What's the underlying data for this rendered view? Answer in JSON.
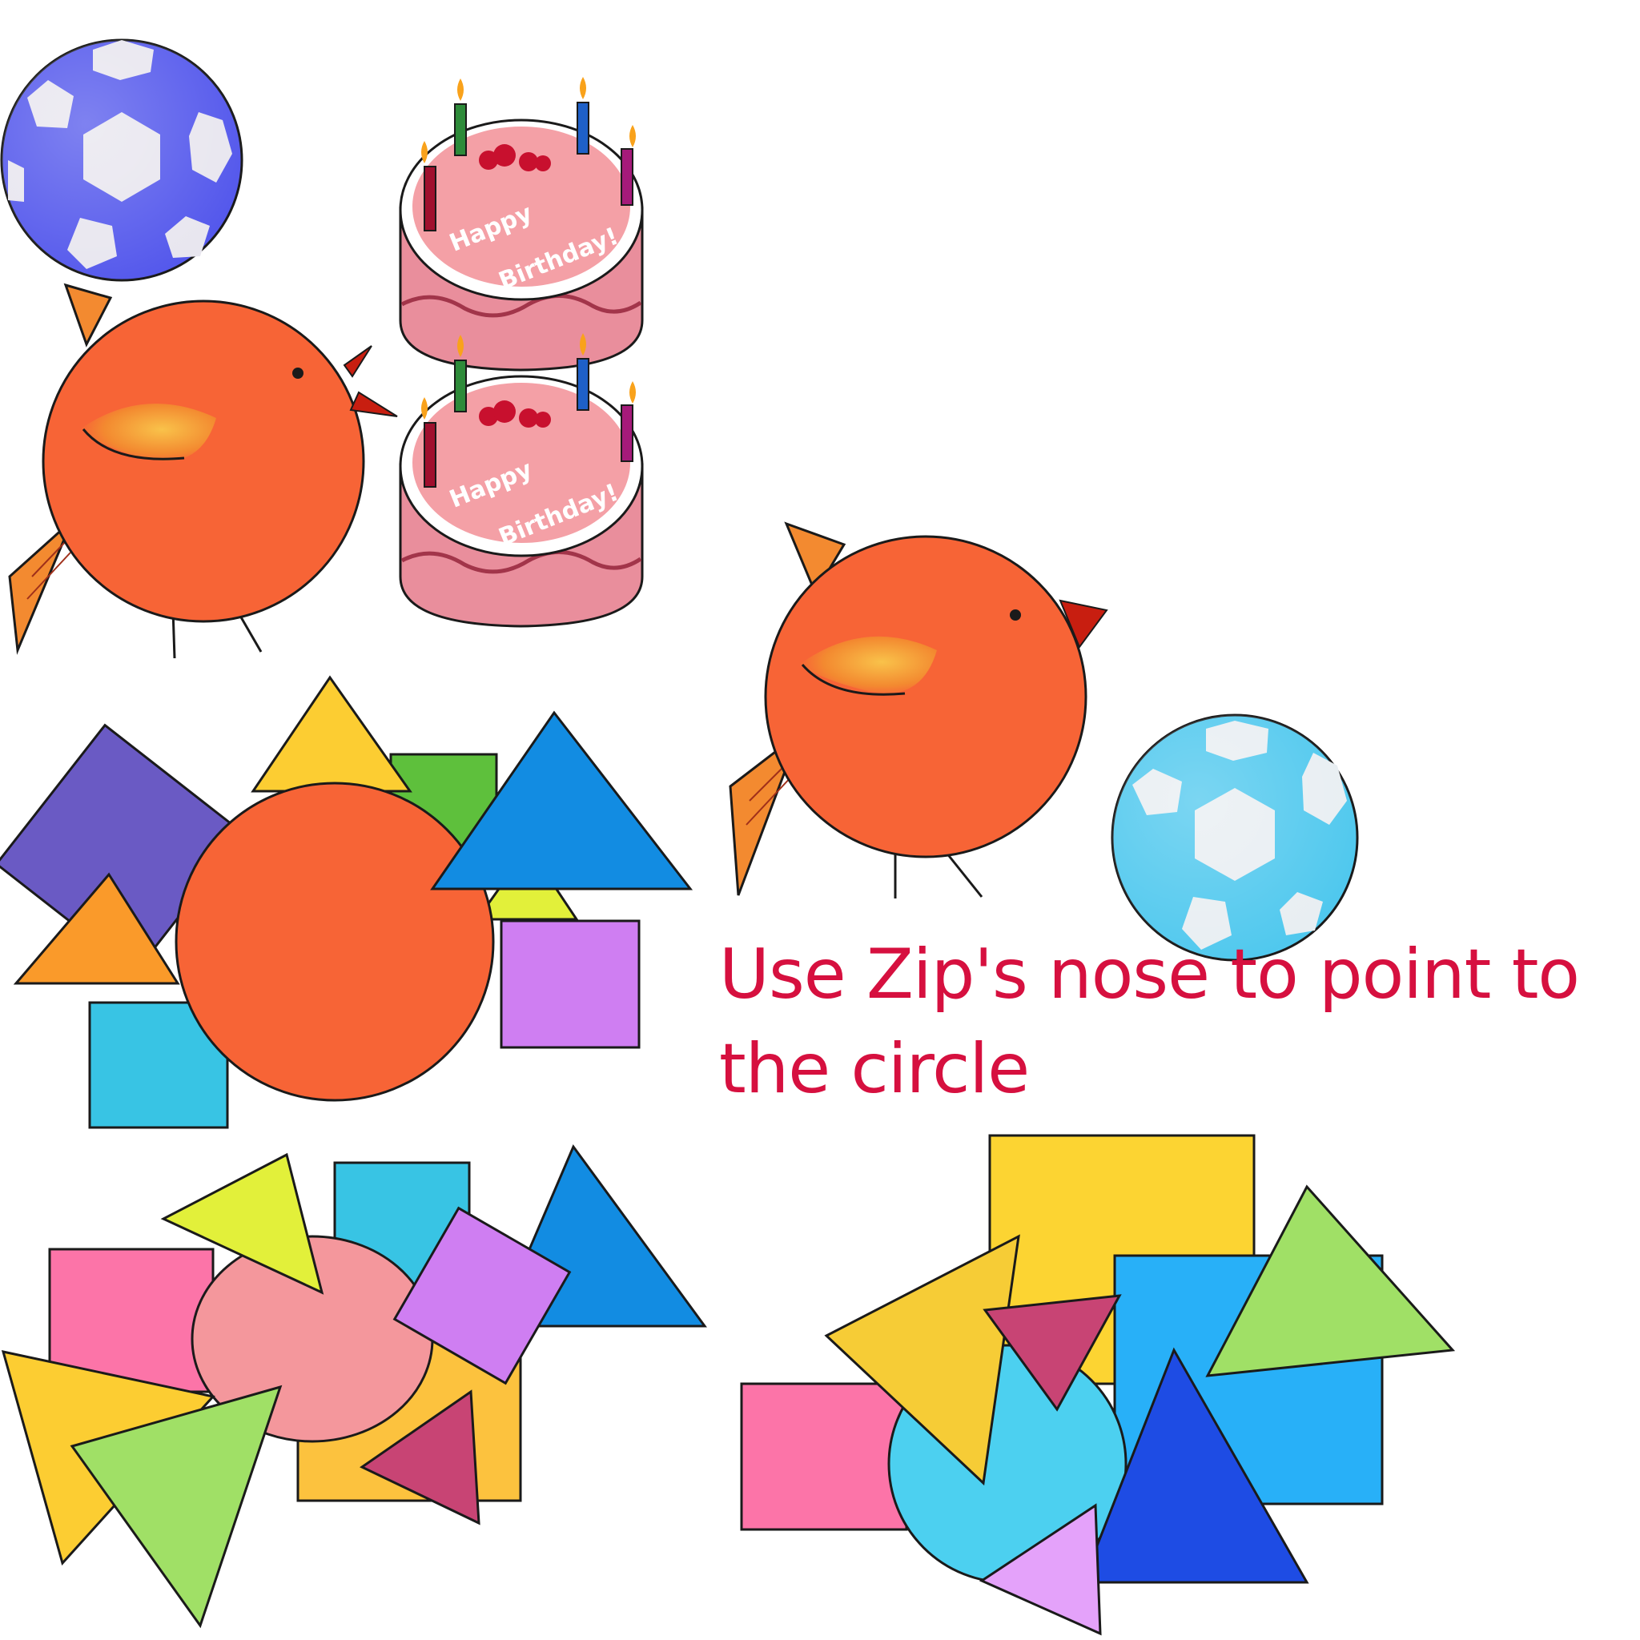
{
  "instruction": {
    "line1": "Use Zip's nose to point to",
    "line2": "the circle"
  },
  "cake": {
    "text_line1": "Happy",
    "text_line2": "Birthday!"
  },
  "colors": {
    "instruction": "#d6103f",
    "bird": "#f76436",
    "beak": "#c81e10",
    "ball_blue": "#5458ec",
    "ball_light_blue": "#4fc8ee",
    "cake_pink": "#f4a0a6",
    "outline": "#1a1a1a"
  },
  "icons": [
    "soccer-ball-icon",
    "birthday-cake-icon",
    "bird-icon",
    "circle-shape",
    "triangle-shape",
    "square-shape"
  ]
}
